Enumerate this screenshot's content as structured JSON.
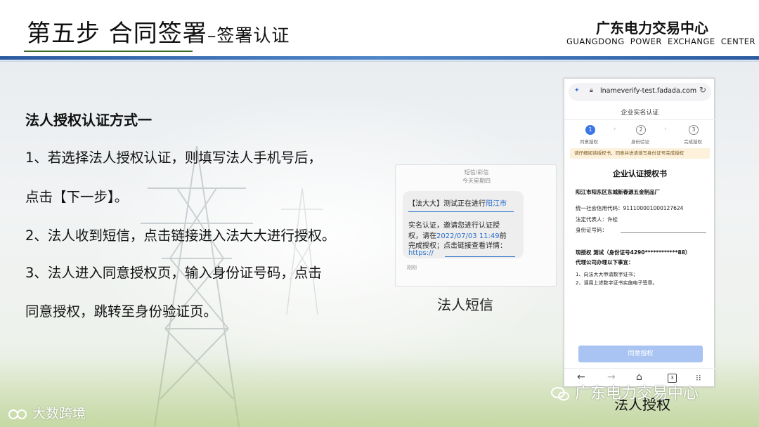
{
  "header": {
    "title_main": "第五步  合同签署",
    "title_sub": "–签署认证",
    "org_cn": "广东电力交易中心",
    "org_en": "GUANGDONG POWER EXCHANGE CENTER"
  },
  "content": {
    "heading": "法人授权认证方式一",
    "lines": [
      "1、若选择法人授权认证，则填写法人手机号后，",
      "点击【下一步】。",
      "2、法人收到短信，点击链接进入法大大进行授权。",
      "3、法人进入同意授权页，输入身份证号码，点击",
      "同意授权，跳转至身份验证页。"
    ]
  },
  "sms": {
    "header1": "短信/彩信",
    "header2": "今天星期四",
    "line1_prefix": "【法大大】测试正在进行",
    "line1_link": "阳江市",
    "line2": "实名认证，邀请您进行认证授",
    "line3_prefix": "权，请在",
    "line3_link": "2022/07/03 11:49",
    "line3_suffix": "前",
    "line4": "完成授权；点击链接查看详情：",
    "line5_link": "https://",
    "footer": "刚刚",
    "caption": "法人短信"
  },
  "phone": {
    "url": "lnameverify-test.fadada.com",
    "page_title": "企业实名认证",
    "steps": [
      {
        "num": "1",
        "label": "同意授权"
      },
      {
        "num": "2",
        "label": "身份验证"
      },
      {
        "num": "3",
        "label": "完成授权"
      }
    ],
    "notice": "请仔细阅读授权书，同意并进请填写身份证号完成授权",
    "doc_title": "企业认证授权书",
    "company": "阳江市阳东区东城新春源五金制品厂",
    "credit_code": "统一社会信用代码：91110000100012762​4",
    "legal_rep": "法定代表人：许松",
    "id_label": "身份证号码：",
    "auth_line1": "现授权 测试（身份证号4290************88）",
    "auth_line2": "代理公司办理以下事宜：",
    "item1": "1、向法大大申请数字证书；",
    "item2": "2、调用上述数字证书实施电子签章。",
    "agree_button": "同意授权",
    "tab_count": "3",
    "caption": "法人授权"
  },
  "watermarks": {
    "left": "大数跨境",
    "right": "广东电力交易中心"
  },
  "colors": {
    "header_bar": "#2a5aa0",
    "link": "#2b6fcc",
    "step_active": "#3b76e6",
    "button": "#a9c4f2"
  }
}
